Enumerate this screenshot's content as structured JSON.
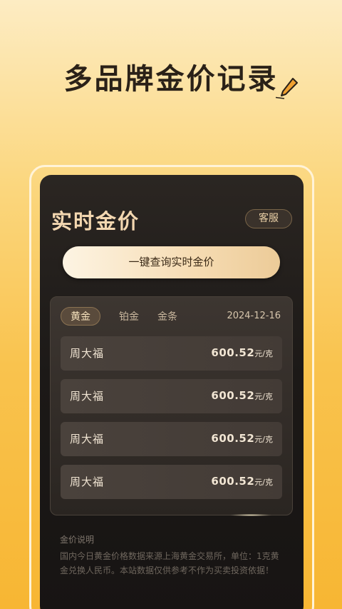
{
  "headline": "多品牌金价记录",
  "screen": {
    "title": "实时金价",
    "service_label": "客服",
    "query_label": "一键查询实时金价",
    "tabs": [
      {
        "label": "黄金",
        "active": true
      },
      {
        "label": "铂金",
        "active": false
      },
      {
        "label": "金条",
        "active": false
      }
    ],
    "date": "2024-12-16",
    "rows": [
      {
        "name": "周大福",
        "price": "600.52",
        "unit": "元/克"
      },
      {
        "name": "周大福",
        "price": "600.52",
        "unit": "元/克"
      },
      {
        "name": "周大福",
        "price": "600.52",
        "unit": "元/克"
      },
      {
        "name": "周大福",
        "price": "600.52",
        "unit": "元/克"
      }
    ],
    "note_title": "金价说明",
    "note_body": "国内今日黄金价格数据来源上海黄金交易所，单位：1克黄金兑换人民币。本站数据仅供参考不作为买卖投资依据！"
  },
  "colors": {
    "accent": "#f9c34e",
    "text_dark": "#2a2118",
    "title_gold": "#f3d7b0"
  },
  "icons": [
    "pen-icon"
  ]
}
